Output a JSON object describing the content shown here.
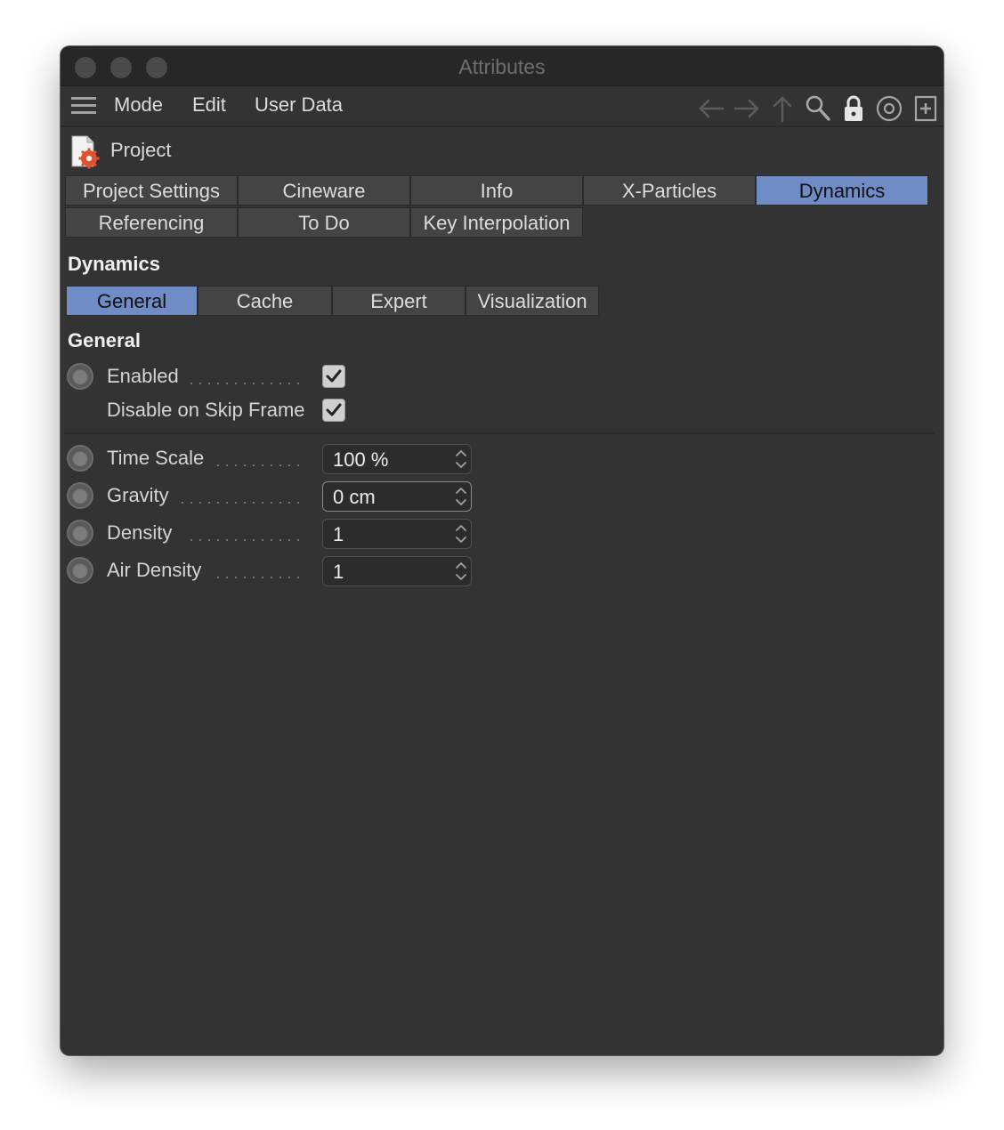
{
  "window": {
    "title": "Attributes"
  },
  "menu": {
    "mode": "Mode",
    "edit": "Edit",
    "user_data": "User Data"
  },
  "object": {
    "name": "Project"
  },
  "tabs": [
    {
      "label": "Project Settings",
      "active": false
    },
    {
      "label": "Cineware",
      "active": false
    },
    {
      "label": "Info",
      "active": false
    },
    {
      "label": "X-Particles",
      "active": false
    },
    {
      "label": "Dynamics",
      "active": true
    },
    {
      "label": "Referencing",
      "active": false
    },
    {
      "label": "To Do",
      "active": false
    },
    {
      "label": "Key Interpolation",
      "active": false
    }
  ],
  "dynamics": {
    "title": "Dynamics",
    "subtabs": [
      {
        "label": "General",
        "active": true
      },
      {
        "label": "Cache",
        "active": false
      },
      {
        "label": "Expert",
        "active": false
      },
      {
        "label": "Visualization",
        "active": false
      }
    ]
  },
  "general": {
    "title": "General",
    "enabled": {
      "label": "Enabled",
      "checked": true
    },
    "disable_skip": {
      "label": "Disable on Skip Frame",
      "checked": true
    }
  },
  "params": {
    "time_scale": {
      "label": "Time Scale",
      "value": "100 %"
    },
    "gravity": {
      "label": "Gravity",
      "value": "0 cm"
    },
    "density": {
      "label": "Density",
      "value": "1"
    },
    "air_density": {
      "label": "Air Density",
      "value": "1"
    }
  },
  "colors": {
    "panel": "#333333",
    "active_tab": "#6f8cc6",
    "object_icon_accent": "#e2502d"
  },
  "icons": [
    "hamburger-menu-icon",
    "back-arrow-icon",
    "forward-arrow-icon",
    "up-arrow-icon",
    "search-icon",
    "lock-icon",
    "target-icon",
    "new-panel-icon",
    "project-icon",
    "checkmark-icon",
    "stepper-icon"
  ]
}
